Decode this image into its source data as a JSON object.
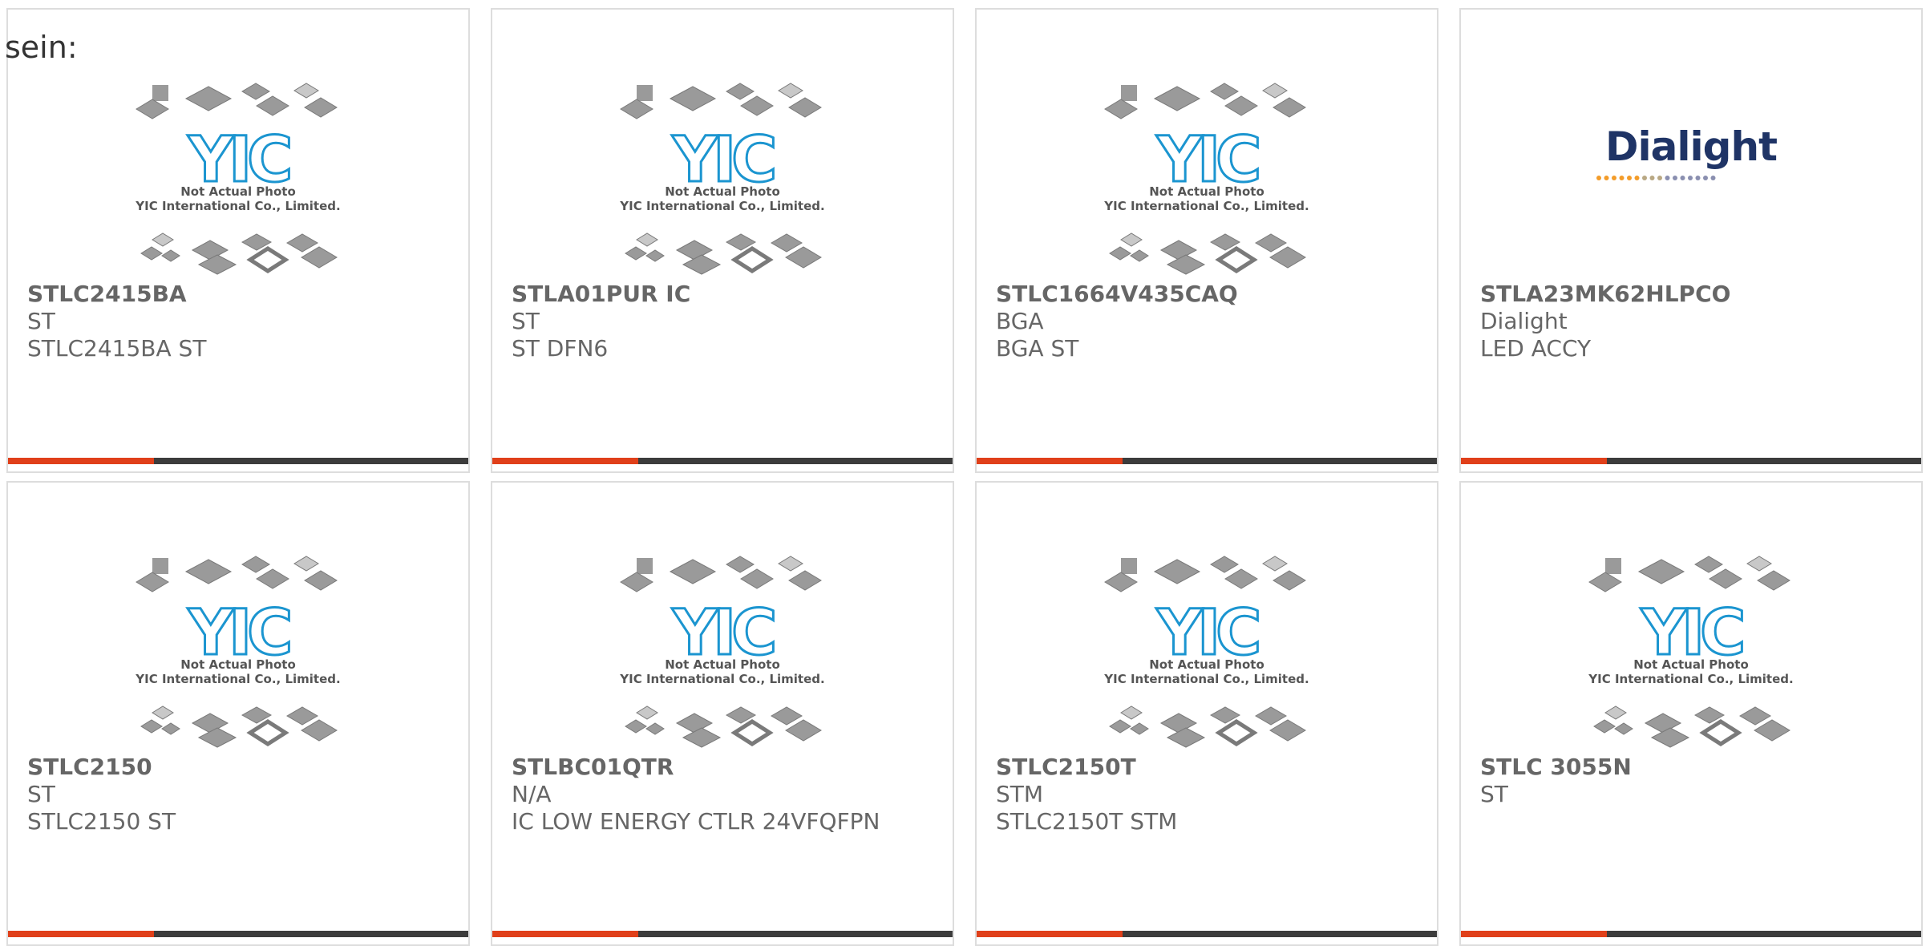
{
  "lead_text": "sein:",
  "colors": {
    "accent": "#e0401a",
    "bar": "#3c3c3c",
    "card_border": "#dddddd",
    "text": "#666666",
    "yic_blue": "#1b95d0",
    "yic_dark": "#23487f",
    "dialight_navy": "#1f3466",
    "dialight_orange": "#f39c2a"
  },
  "placeholder": {
    "line1": "Not Actual Photo",
    "line2": "YIC International Co., Limited.",
    "logo_text": "YIC",
    "icon": "yic-placeholder-icon"
  },
  "products": [
    {
      "part_number": "STLC2415BA",
      "manufacturer": "ST",
      "description": "STLC2415BA ST",
      "image": "yic-placeholder"
    },
    {
      "part_number": "STLA01PUR IC",
      "manufacturer": "ST",
      "description": "ST DFN6",
      "image": "yic-placeholder"
    },
    {
      "part_number": "STLC1664V435CAQ",
      "manufacturer": "BGA",
      "description": "BGA ST",
      "image": "yic-placeholder"
    },
    {
      "part_number": "STLA23MK62HLPCO",
      "manufacturer": "Dialight",
      "description": "LED ACCY",
      "image": "dialight-logo",
      "logo_text": "Dialight"
    },
    {
      "part_number": "STLC2150",
      "manufacturer": "ST",
      "description": "STLC2150 ST",
      "image": "yic-placeholder"
    },
    {
      "part_number": "STLBC01QTR",
      "manufacturer": "N/A",
      "description": "IC LOW ENERGY CTLR 24VFQFPN",
      "image": "yic-placeholder"
    },
    {
      "part_number": "STLC2150T",
      "manufacturer": "STM",
      "description": "STLC2150T STM",
      "image": "yic-placeholder"
    },
    {
      "part_number": "STLC 3055N",
      "manufacturer": "ST",
      "description": "",
      "image": "yic-placeholder"
    }
  ]
}
